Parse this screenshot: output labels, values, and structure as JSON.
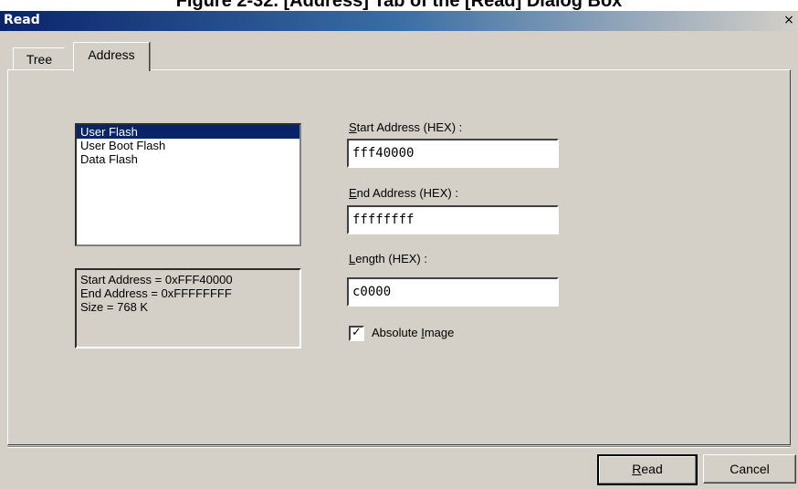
{
  "caption": "Figure 2-32. [Address] Tab of the [Read] Dialog Box",
  "window": {
    "title": "Read",
    "close_glyph": "×"
  },
  "tabs": [
    {
      "label": "Tree",
      "active": false
    },
    {
      "label": "Address",
      "active": true
    }
  ],
  "area_list": {
    "items": [
      "User Flash",
      "User Boot Flash",
      "Data Flash"
    ],
    "selected": "User Flash"
  },
  "info": {
    "start": "Start Address = 0xFFF40000",
    "end": "End Address = 0xFFFFFFFF",
    "size": "Size = 768 K"
  },
  "fields": {
    "start_address": {
      "label_key": "S",
      "label_rest": "tart Address (HEX) :",
      "value": "fff40000"
    },
    "end_address": {
      "label_key": "E",
      "label_rest": "nd Address (HEX) :",
      "value": "ffffffff"
    },
    "length": {
      "label_key": "L",
      "label_rest": "ength (HEX) :",
      "value": "c0000"
    }
  },
  "absolute_image": {
    "label_prefix": "Absolute ",
    "label_key": "I",
    "label_rest": "mage",
    "checked": true,
    "check_glyph": "✓"
  },
  "buttons": {
    "read": {
      "key": "R",
      "rest": "ead"
    },
    "cancel": {
      "label": "Cancel"
    }
  },
  "colors": {
    "titlebar_start": "#0a246a",
    "face": "#d4d0c8",
    "selection": "#0a246a"
  }
}
